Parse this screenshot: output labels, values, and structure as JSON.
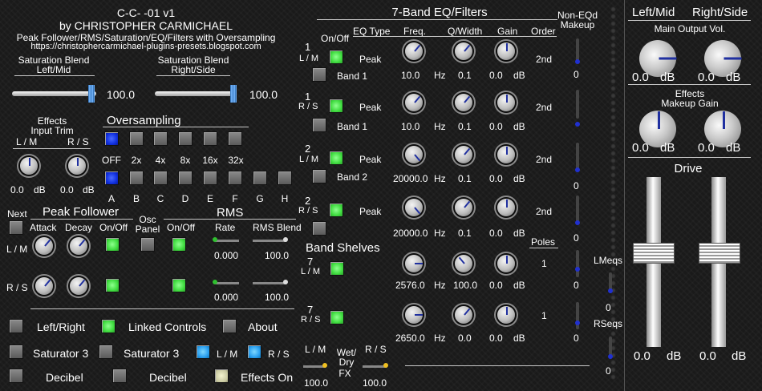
{
  "header": {
    "title": "C-C- -01 v1",
    "author": "by CHRISTOPHER CARMICHAEL",
    "subtitle": "Peak Follower/RMS/Saturation/EQ/Filters with Oversampling",
    "url": "https://christophercarmichael-plugins-presets.blogspot.com"
  },
  "saturation": {
    "left_label_1": "Saturation Blend",
    "left_label_2": "Left/Mid",
    "left_value": "100.0",
    "right_label_1": "Saturation Blend",
    "right_label_2": "Right/Side",
    "right_value": "100.0"
  },
  "input_trim": {
    "label_1": "Effects",
    "label_2": "Input Trim",
    "lm_label": "L / M",
    "rs_label": "R / S",
    "lm_value": "0.0",
    "rs_value": "0.0",
    "unit": "dB"
  },
  "oversampling": {
    "title": "Oversampling",
    "factors": [
      "OFF",
      "2x",
      "4x",
      "8x",
      "16x",
      "32x"
    ],
    "modes": [
      "A",
      "B",
      "C",
      "D",
      "E",
      "F",
      "G",
      "H"
    ]
  },
  "peak_follower": {
    "next_label": "Next",
    "title": "Peak Follower",
    "attack": "Attack",
    "decay": "Decay",
    "onoff": "On/Off",
    "osc_1": "Osc",
    "osc_2": "Panel",
    "lm": "L / M",
    "rs": "R / S"
  },
  "rms": {
    "title": "RMS",
    "onoff": "On/Off",
    "rate": "Rate",
    "blend": "RMS Blend",
    "rate_lm": "0.000",
    "blend_lm": "100.0",
    "rate_rs": "0.000",
    "blend_rs": "100.0"
  },
  "bottom_controls": {
    "left_right": "Left/Right",
    "linked": "Linked Controls",
    "about": "About",
    "sat3_a": "Saturator 3",
    "sat3_b": "Saturator 3",
    "lm": "L / M",
    "rs": "R / S",
    "decibel_a": "Decibel",
    "decibel_b": "Decibel",
    "effects_on": "Effects On"
  },
  "eq": {
    "title": "7-Band EQ/Filters",
    "onoff": "On/Off",
    "col_type": "EQ Type",
    "col_freq": "Freq.",
    "col_q": "Q/Width",
    "col_gain": "Gain",
    "col_order": "Order",
    "hz": "Hz",
    "db": "dB",
    "poles": "Poles",
    "shelves_title": "Band Shelves",
    "bands": [
      {
        "num": "1",
        "ch": "L / M",
        "type": "Peak",
        "band": "Band 1",
        "freq": "10.0",
        "q": "0.1",
        "gain": "0.0",
        "order": "2nd",
        "makeup": "0"
      },
      {
        "num": "1",
        "ch": "R / S",
        "type": "Peak",
        "band": "Band 1",
        "freq": "10.0",
        "q": "0.1",
        "gain": "0.0",
        "order": "2nd",
        "makeup": ""
      },
      {
        "num": "2",
        "ch": "L / M",
        "type": "Peak",
        "band": "Band 2",
        "freq": "20000.0",
        "q": "0.1",
        "gain": "0.0",
        "order": "2nd",
        "makeup": "0"
      },
      {
        "num": "2",
        "ch": "R / S",
        "type": "Peak",
        "band": "",
        "freq": "20000.0",
        "q": "0.1",
        "gain": "0.0",
        "order": "2nd",
        "makeup": "0"
      },
      {
        "num": "7",
        "ch": "L / M",
        "freq": "2576.0",
        "q": "100.0",
        "gain": "0.0",
        "order": "1",
        "makeup": "0"
      },
      {
        "num": "7",
        "ch": "R / S",
        "freq": "2650.0",
        "q": "0.0",
        "gain": "0.0",
        "order": "1",
        "makeup": "0"
      }
    ],
    "wetdry_lm": "L / M",
    "wetdry_rs": "R / S",
    "wetdry_1": "Wet/",
    "wetdry_2": "Dry",
    "wetdry_3": "FX",
    "wetdry_lm_value": "100.0",
    "wetdry_rs_value": "100.0"
  },
  "makeup": {
    "title_1": "Non-EQd",
    "title_2": "Makeup",
    "lm_label": "LMeqs",
    "lm_value": "0",
    "rs_label": "RSeqs",
    "rs_value": "0"
  },
  "output": {
    "left_label": "Left/Mid",
    "right_label": "Right/Side",
    "main_vol": "Main Output Vol.",
    "left_vol": "0.0",
    "right_vol": "0.0",
    "makeup_1": "Effects",
    "makeup_2": "Makeup Gain",
    "left_makeup": "0.0",
    "right_makeup": "0.0",
    "unit": "dB",
    "drive": "Drive",
    "drive_left": "0.0",
    "drive_right": "0.0"
  }
}
